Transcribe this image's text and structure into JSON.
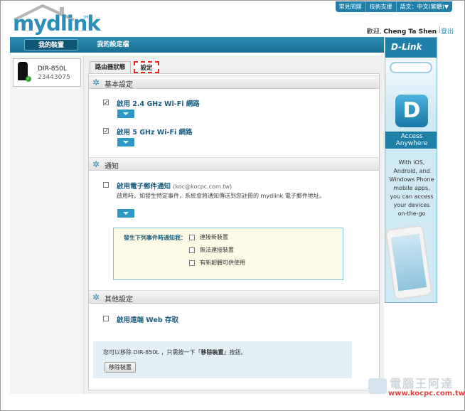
{
  "top_links": [
    "常見問題",
    "技術支援",
    "語文：中文(繁體)▼"
  ],
  "logo": {
    "my": "my",
    "dlink": "dlink",
    "tm": "TM"
  },
  "user": {
    "welcome": "歡迎,",
    "name": "Cheng Ta Shen",
    "sep": "|",
    "logout": "登出"
  },
  "nav": {
    "my_devices": "我的裝置",
    "my_settings": "我的設定檔"
  },
  "device": {
    "name": "DIR-850L",
    "id": "23443075"
  },
  "tabs": {
    "router_status": "路由器狀態",
    "settings": "設定"
  },
  "sections": {
    "basic": "基本設定",
    "notify": "通知",
    "other": "其他設定"
  },
  "basic": {
    "wifi24": "啟用 2.4 GHz Wi-Fi 網路",
    "wifi5": "啟用 5 GHz Wi-Fi 網路",
    "check": "✓"
  },
  "notify": {
    "email_label": "啟用電子郵件通知",
    "email_addr": "(koc@kocpc.com.tw)",
    "desc": "啟用時，如發生特定事件，系統會將通知傳送到您註冊的 mydlink 電子郵件地址。",
    "box_title": "發生下列事件時通知我：",
    "options": [
      "連接新裝置",
      "無法連接裝置",
      "有新韌體可供使用"
    ]
  },
  "other": {
    "remote": "啟用遠端 Web 存取",
    "info_pre": "您可以移除 DIR-850L ，只需按一下「",
    "info_bold": "移除裝置",
    "info_post": "」按鈕。",
    "remove_button": "移除裝置"
  },
  "ad": {
    "brand": "D-Link",
    "access": "Access",
    "anywhere": "Anywhere",
    "lines": [
      "With iOS,",
      "Android, and",
      "Windows Phone",
      "mobile apps,",
      "you can access",
      "your devices",
      "on-the-go"
    ]
  },
  "watermark": {
    "title": "電腦王阿達",
    "url": "www.kocpc.com.tw"
  }
}
